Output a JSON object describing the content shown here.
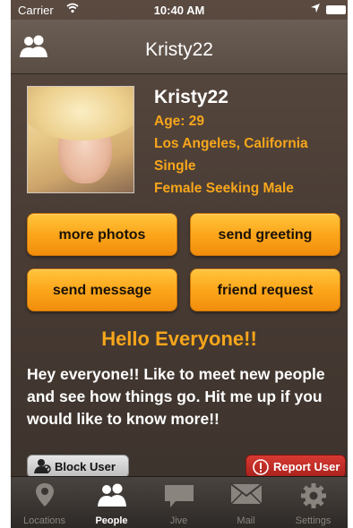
{
  "status_bar": {
    "carrier": "Carrier",
    "time": "10:40 AM"
  },
  "nav": {
    "title": "Kristy22"
  },
  "profile": {
    "name": "Kristy22",
    "age": "Age: 29",
    "location": "Los Angeles, California",
    "status": "Single",
    "seeking": "Female Seeking Male"
  },
  "actions": {
    "more_photos": "more photos",
    "send_greeting": "send greeting",
    "send_message": "send message",
    "friend_request": "friend request"
  },
  "greeting_title": "Hello Everyone!!",
  "about_text": "Hey everyone!! Like to meet new people and see how things go. Hit me up if you would like to know more!!",
  "block_user": "Block User",
  "report_user": "Report User",
  "tabs": [
    {
      "label": "Locations",
      "icon": "location-pin-icon"
    },
    {
      "label": "People",
      "icon": "people-icon"
    },
    {
      "label": "Jive",
      "icon": "chat-bubble-icon"
    },
    {
      "label": "Mail",
      "icon": "mail-icon"
    },
    {
      "label": "Settings",
      "icon": "gear-icon"
    }
  ],
  "active_tab": "People",
  "colors": {
    "accent": "#f7a61b",
    "report": "#c62d26"
  }
}
